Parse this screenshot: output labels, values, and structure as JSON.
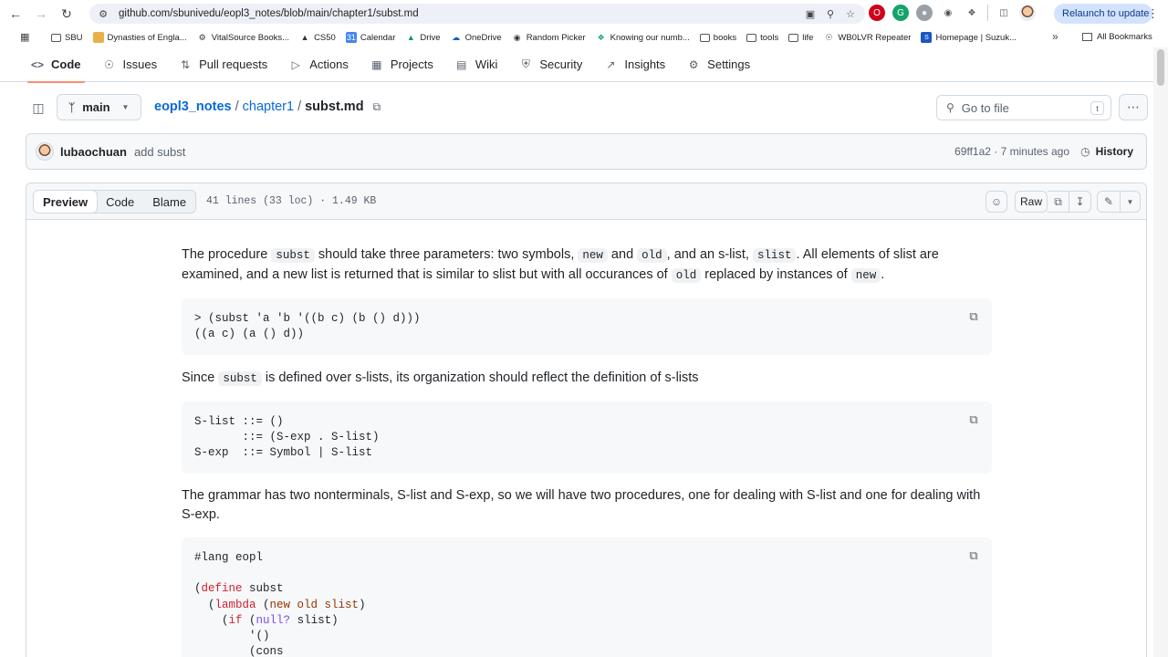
{
  "browser": {
    "url": "github.com/sbunivedu/eopl3_notes/blob/main/chapter1/subst.md",
    "relaunch": "Relaunch to update",
    "bookmarks": [
      "SBU",
      "Dynasties of Engla...",
      "VitalSource Books...",
      "CS50",
      "Calendar",
      "Drive",
      "OneDrive",
      "Random Picker",
      "Knowing our numb...",
      "books",
      "tools",
      "life",
      "WB0LVR Repeater",
      "Homepage | Suzuk..."
    ],
    "all_bookmarks": "All Bookmarks"
  },
  "repo_nav": {
    "code": "Code",
    "issues": "Issues",
    "pulls": "Pull requests",
    "actions": "Actions",
    "projects": "Projects",
    "wiki": "Wiki",
    "security": "Security",
    "insights": "Insights",
    "settings": "Settings"
  },
  "file_header": {
    "branch": "main",
    "repo": "eopl3_notes",
    "folder": "chapter1",
    "file": "subst.md",
    "goto": "Go to file",
    "goto_key": "t"
  },
  "commit": {
    "author": "lubaochuan",
    "message": "add subst",
    "meta": "69ff1a2 · 7 minutes ago",
    "history": "History"
  },
  "viewer": {
    "tabs": [
      "Preview",
      "Code",
      "Blame"
    ],
    "info": "41 lines (33 loc) · 1.49 KB",
    "raw": "Raw"
  },
  "content": {
    "p1": {
      "a": "The procedure ",
      "c1": "subst",
      "b": " should take three parameters: two symbols, ",
      "c2": "new",
      "c": " and ",
      "c3": "old",
      "d": ", and an s-list, ",
      "c4": "slist",
      "e": ". All elements of slist are examined, and a new list is returned that is similar to slist but with all occurances of ",
      "c5": "old",
      "f": " replaced by instances of ",
      "c6": "new",
      "g": "."
    },
    "code1": "> (subst 'a 'b '((b c) (b () d)))\n((a c) (a () d))",
    "p2": {
      "a": "Since ",
      "c1": "subst",
      "b": " is defined over s-lists, its organization should reflect the definition of s-lists"
    },
    "code2": "S-list ::= ()\n       ::= (S-exp . S-list)\nS-exp  ::= Symbol | S-list",
    "p3": "The grammar has two nonterminals, S-list and S-exp, so we will have two procedures, one for dealing with S-list and one for dealing with S-exp.",
    "code3": {
      "l1": "#lang eopl",
      "l3a": "(",
      "l3kw": "define",
      "l3b": " subst",
      "l4a": "  (",
      "l4kw": "lambda",
      "l4b": " (",
      "l4args": "new old slist",
      "l4c": ")",
      "l5a": "    (",
      "l5kw": "if",
      "l5b": " (",
      "l5fn": "null?",
      "l5c": " slist)",
      "l6": "        '()",
      "l7": "        (cons"
    }
  }
}
